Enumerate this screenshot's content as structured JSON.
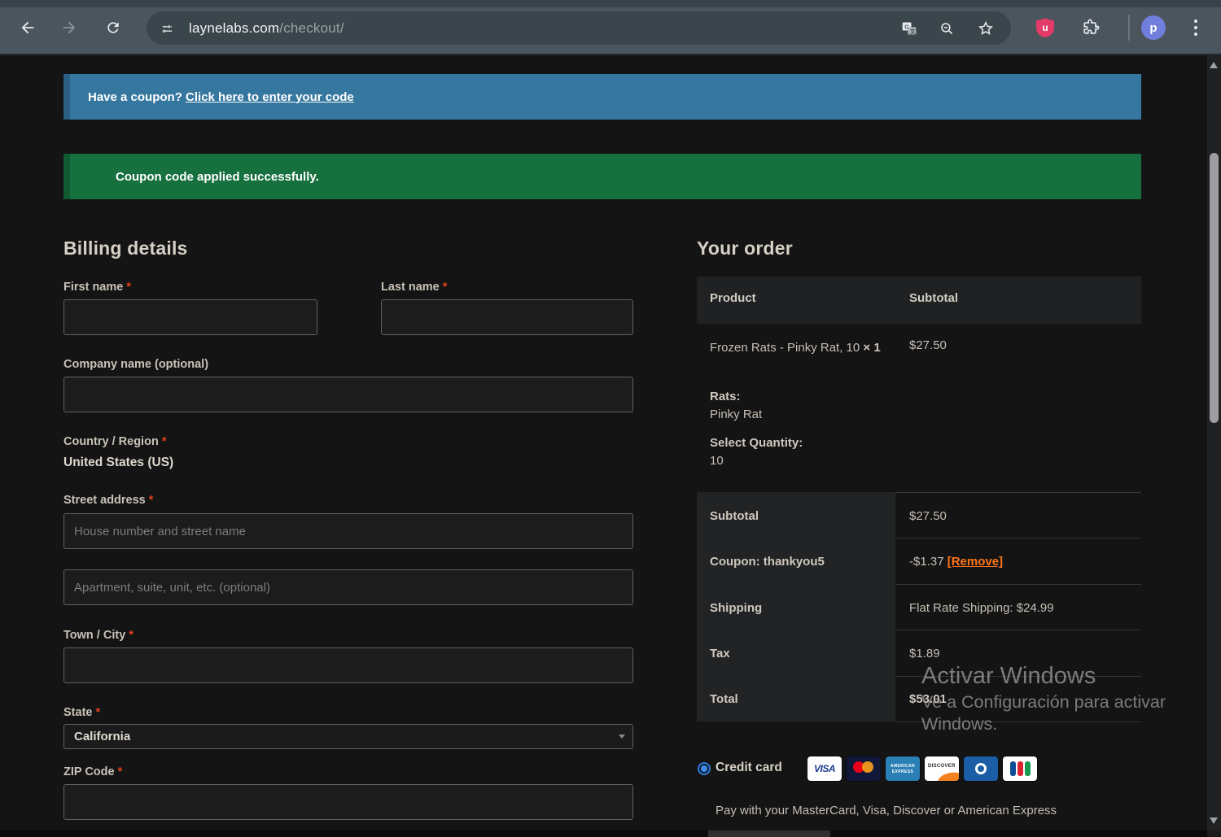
{
  "browser": {
    "url_host": "laynelabs.com",
    "url_path": "/checkout/",
    "avatar_letter": "p",
    "ublock_letter": "u"
  },
  "banners": {
    "coupon_prompt": "Have a coupon? ",
    "coupon_link": "Click here to enter your code",
    "coupon_success": "Coupon code applied successfully."
  },
  "billing": {
    "title": "Billing details",
    "required_mark": "*",
    "first_name_label": "First name",
    "last_name_label": "Last name",
    "company_label": "Company name (optional)",
    "country_label": "Country / Region",
    "country_value": "United States (US)",
    "street_label": "Street address",
    "street_placeholder": "House number and street name",
    "street2_placeholder": "Apartment, suite, unit, etc. (optional)",
    "city_label": "Town / City",
    "state_label": "State",
    "state_value": "California",
    "zip_label": "ZIP Code"
  },
  "order": {
    "title": "Your order",
    "col_product": "Product",
    "col_subtotal": "Subtotal",
    "item_name": "Frozen Rats - Pinky Rat, 10",
    "item_qty": "× 1",
    "item_price": "$27.50",
    "attr_rats_label": "Rats:",
    "attr_rats_value": "Pinky Rat",
    "attr_qty_label": "Select Quantity:",
    "attr_qty_value": "10",
    "coupon_remove": "[Remove]",
    "totals": [
      {
        "label": "Subtotal",
        "value": "$27.50"
      },
      {
        "label": "Coupon: thankyou5",
        "value": "-$1.37 "
      },
      {
        "label": "Shipping",
        "value": "Flat Rate Shipping: $24.99"
      },
      {
        "label": "Tax",
        "value": "$1.89"
      },
      {
        "label": "Total",
        "value": "$53.01"
      }
    ]
  },
  "payment": {
    "method_label": "Credit card",
    "description": "Pay with your MasterCard, Visa, Discover or American Express",
    "visa_label": "VISA",
    "amex_line1": "AMERICAN",
    "amex_line2": "EXPRESS",
    "discover_label": "DISCOVER"
  },
  "watermark": {
    "line1": "Activar Windows",
    "line2": "Ve a Configuración para activar",
    "line3": "Windows."
  },
  "colors": {
    "coupon_banner_blue": "#35779f",
    "success_banner_green": "#17713f",
    "required_red": "#e2401c",
    "remove_link_orange": "#ff7518",
    "radio_accent_blue": "#2f7cd6",
    "browser_chrome": "#4a555d",
    "page_background": "#141414"
  }
}
